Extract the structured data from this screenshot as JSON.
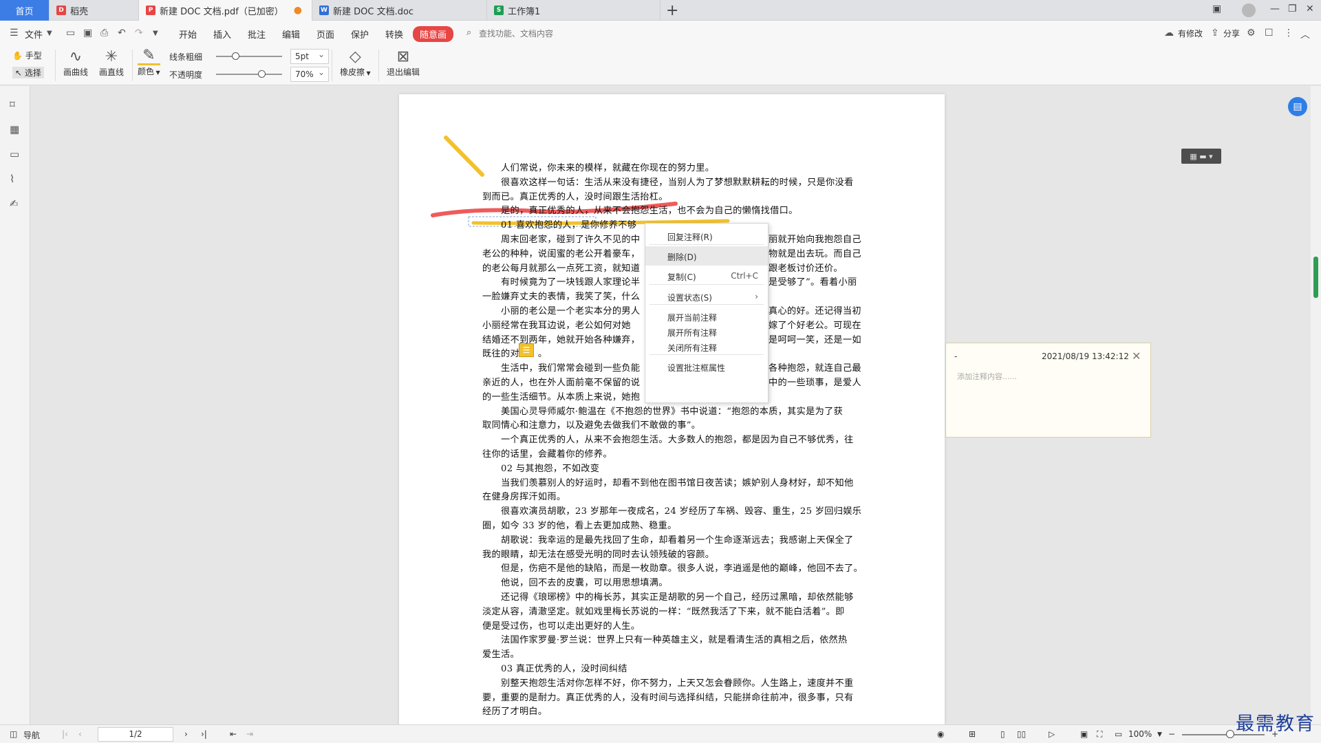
{
  "tabs": [
    {
      "label": "首页",
      "type": "home"
    },
    {
      "label": "稻壳",
      "type": "app"
    },
    {
      "label": "新建 DOC 文档.pdf（已加密）",
      "type": "pdf",
      "active": true,
      "modified_dot": "●"
    },
    {
      "label": "新建 DOC 文档.doc",
      "type": "doc"
    },
    {
      "label": "工作簿1",
      "type": "sheet"
    }
  ],
  "menu": {
    "file": "文件",
    "items": [
      "开始",
      "插入",
      "批注",
      "编辑",
      "页面",
      "保护",
      "转换"
    ],
    "special": "随意画",
    "search_placeholder": "查找功能、文档内容",
    "right": {
      "revise": "有修改",
      "share": "分享"
    }
  },
  "toolbar": {
    "hand": "手型",
    "select": "选择",
    "draw_curve": "画曲线",
    "draw_line": "画直线",
    "color": "颜色",
    "line_width_label": "线条粗细",
    "opacity_label": "不透明度",
    "line_width_value": "5pt",
    "opacity_value": "70%",
    "eraser": "橡皮擦",
    "exit_edit": "退出编辑",
    "line_width_level": 0.3,
    "opacity_level": 0.7
  },
  "document": {
    "lines": [
      {
        "text": "人们常说，你未来的模样，就藏在你现在的努力里。",
        "indent": true
      },
      {
        "text": "很喜欢这样一句话：生活从来没有捷径，当别人为了梦想默默耕耘的时候，只是你没看",
        "indent": true
      },
      {
        "text": "到而已。真正优秀的人，没时间跟生活抬杠。",
        "indent": false
      },
      {
        "text": "是的，真正优秀的人，从来不会抱怨生活，也不会为自己的懒惰找借口。",
        "indent": true
      },
      {
        "text": "01  喜欢抱怨的人，是你修养不够",
        "indent": true
      },
      {
        "text": "周末回老家，碰到了许久不见的中",
        "indent": true,
        "tail": "丽就开始向我抱怨自己"
      },
      {
        "text": "老公的种种，说闺蜜的老公开着豪车，",
        "indent": false,
        "tail": "物就是出去玩。而自己"
      },
      {
        "text": "的老公每月就那么一点死工资，就知道",
        "indent": false,
        "tail": "跟老板讨价还价。"
      },
      {
        "text": "有时候竟为了一块钱跟人家理论半",
        "indent": true,
        "tail": "是受够了”。看着小丽"
      },
      {
        "text": "一脸嫌弃丈夫的表情，我笑了笑，什么",
        "indent": false,
        "tail": ""
      },
      {
        "text": "小丽的老公是一个老实本分的男人",
        "indent": true,
        "tail": "真心的好。还记得当初"
      },
      {
        "text": "小丽经常在我耳边说，老公如何对她",
        "indent": false,
        "tail": "嫁了个好老公。可现在"
      },
      {
        "text": "结婚还不到两年，她就开始各种嫌弃，",
        "indent": false,
        "tail": "是呵呵一笑，还是一如"
      },
      {
        "text": "既往的对　　。",
        "indent": false,
        "tail": ""
      },
      {
        "text": "生活中，我们常常会碰到一些负能",
        "indent": true,
        "tail": "各种抱怨，就连自己最"
      },
      {
        "text": "亲近的人，也在外人面前毫不保留的说",
        "indent": false,
        "tail": "中的一些琐事，是爱人"
      },
      {
        "text": "的一些生活细节。从本质上来说，她抱",
        "indent": false,
        "tail": ""
      },
      {
        "text": "美国心灵导师威尔·鲍温在《不抱怨的世界》书中说道：“抱怨的本质，其实是为了获",
        "indent": true
      },
      {
        "text": "取同情心和注意力，以及避免去做我们不敢做的事”。",
        "indent": false
      },
      {
        "text": "一个真正优秀的人，从来不会抱怨生活。大多数人的抱怨，都是因为自己不够优秀，往",
        "indent": true
      },
      {
        "text": "往你的话里，会藏着你的修养。",
        "indent": false
      },
      {
        "text": "02  与其抱怨，不如改变",
        "indent": true
      },
      {
        "text": "当我们羡慕别人的好运时，却看不到他在图书馆日夜苦读；嫉妒别人身材好，却不知他",
        "indent": true
      },
      {
        "text": "在健身房挥汗如雨。",
        "indent": false
      },
      {
        "text": "很喜欢演员胡歌，23 岁那年一夜成名，24 岁经历了车祸、毁容、重生，25 岁回归娱乐",
        "indent": true
      },
      {
        "text": "圈，如今 33 岁的他，看上去更加成熟、稳重。",
        "indent": false
      },
      {
        "text": "胡歌说：我幸运的是最先找回了生命，却看着另一个生命逐渐远去；我感谢上天保全了",
        "indent": true
      },
      {
        "text": "我的眼睛，却无法在感受光明的同时去认领残破的容颜。",
        "indent": false
      },
      {
        "text": "但是，伤疤不是他的缺陷，而是一枚勋章。很多人说，李逍遥是他的巅峰，他回不去了。",
        "indent": true
      },
      {
        "text": "他说，回不去的皮囊，可以用思想填满。",
        "indent": true
      },
      {
        "text": "还记得《琅琊榜》中的梅长苏，其实正是胡歌的另一个自己，经历过黑暗，却依然能够",
        "indent": true
      },
      {
        "text": "淡定从容，清澈坚定。就如戏里梅长苏说的一样：“既然我活了下来，就不能白活着”。即",
        "indent": false
      },
      {
        "text": "便是受过伤，也可以走出更好的人生。",
        "indent": false
      },
      {
        "text": "法国作家罗曼·罗兰说：世界上只有一种英雄主义，就是看清生活的真相之后，依然热",
        "indent": true
      },
      {
        "text": "爱生活。",
        "indent": false
      },
      {
        "text": "03  真正优秀的人，没时间纠结",
        "indent": true
      },
      {
        "text": "别整天抱怨生活对你怎样不好，你不努力，上天又怎会眷顾你。人生路上，速度并不重",
        "indent": true
      },
      {
        "text": "要，重要的是耐力。真正优秀的人，没有时间与选择纠结，只能拼命往前冲，很多事，只有",
        "indent": false
      },
      {
        "text": "经历了才明白。",
        "indent": false
      }
    ]
  },
  "context_menu": {
    "items": [
      {
        "label": "回复注释(R)"
      },
      {
        "label": "删除(D)",
        "hover": true
      },
      {
        "label": "复制(C)",
        "shortcut": "Ctrl+C"
      },
      {
        "label": "设置状态(S)",
        "submenu": "›"
      },
      {
        "label": "展开当前注释"
      },
      {
        "label": "展开所有注释"
      },
      {
        "label": "关闭所有注释"
      },
      {
        "label": "设置批注框属性"
      }
    ]
  },
  "annotation": {
    "author": "-",
    "timestamp": "2021/08/19 13:42:12",
    "placeholder": "添加注释内容......"
  },
  "status": {
    "nav": "导航",
    "page": "1/2",
    "zoom": "100%"
  },
  "watermark": "最需教育",
  "colors": {
    "accent": "#3b7de4",
    "pen_red": "#ef5b5b",
    "pen_yellow": "#f2c12e",
    "special_tab": "#e84545"
  }
}
